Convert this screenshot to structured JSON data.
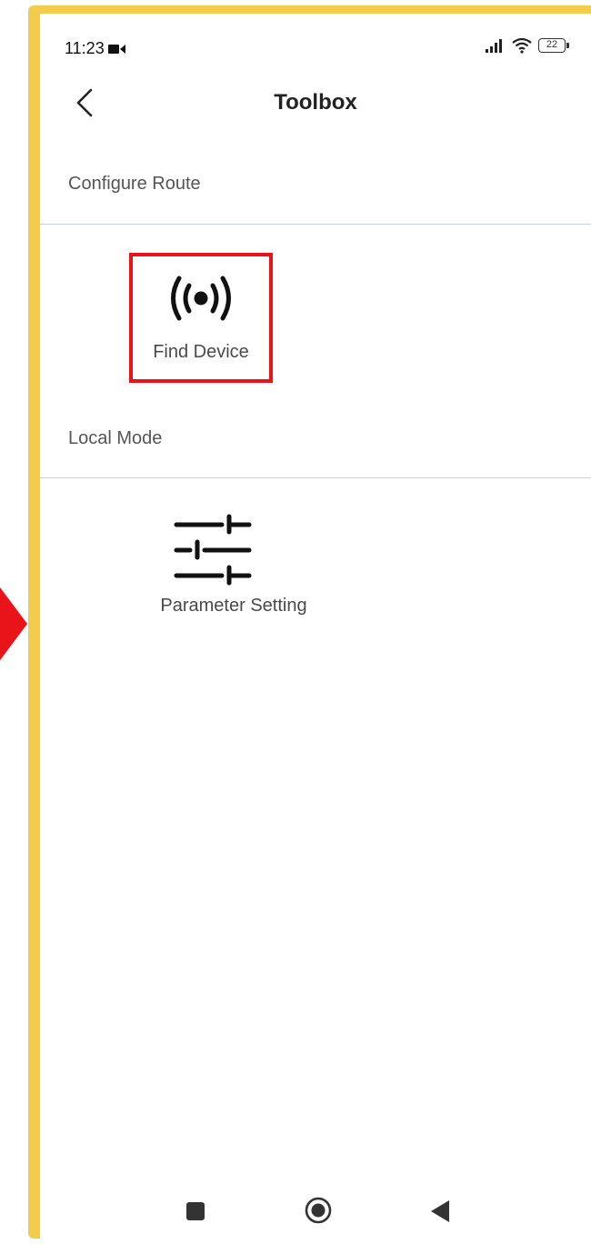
{
  "status_bar": {
    "time": "11:23",
    "battery": "22",
    "icons": [
      "video-camera-icon",
      "signal-icon",
      "wifi-icon",
      "battery-icon"
    ]
  },
  "header": {
    "title": "Toolbox",
    "back_icon": "chevron-left-icon"
  },
  "sections": [
    {
      "title": "Configure Route",
      "tools": [
        {
          "label": "Find Device",
          "icon": "broadcast-icon",
          "highlighted": true
        }
      ]
    },
    {
      "title": "Local Mode",
      "tools": [
        {
          "label": "Parameter Setting",
          "icon": "sliders-icon",
          "highlighted": false
        }
      ]
    }
  ],
  "nav_bar": {
    "icons": [
      "recents-square-icon",
      "home-circle-icon",
      "back-triangle-icon"
    ]
  },
  "colors": {
    "frame": "#f2cc4a",
    "highlight": "#e8141a",
    "divider": "#c9d0da"
  }
}
